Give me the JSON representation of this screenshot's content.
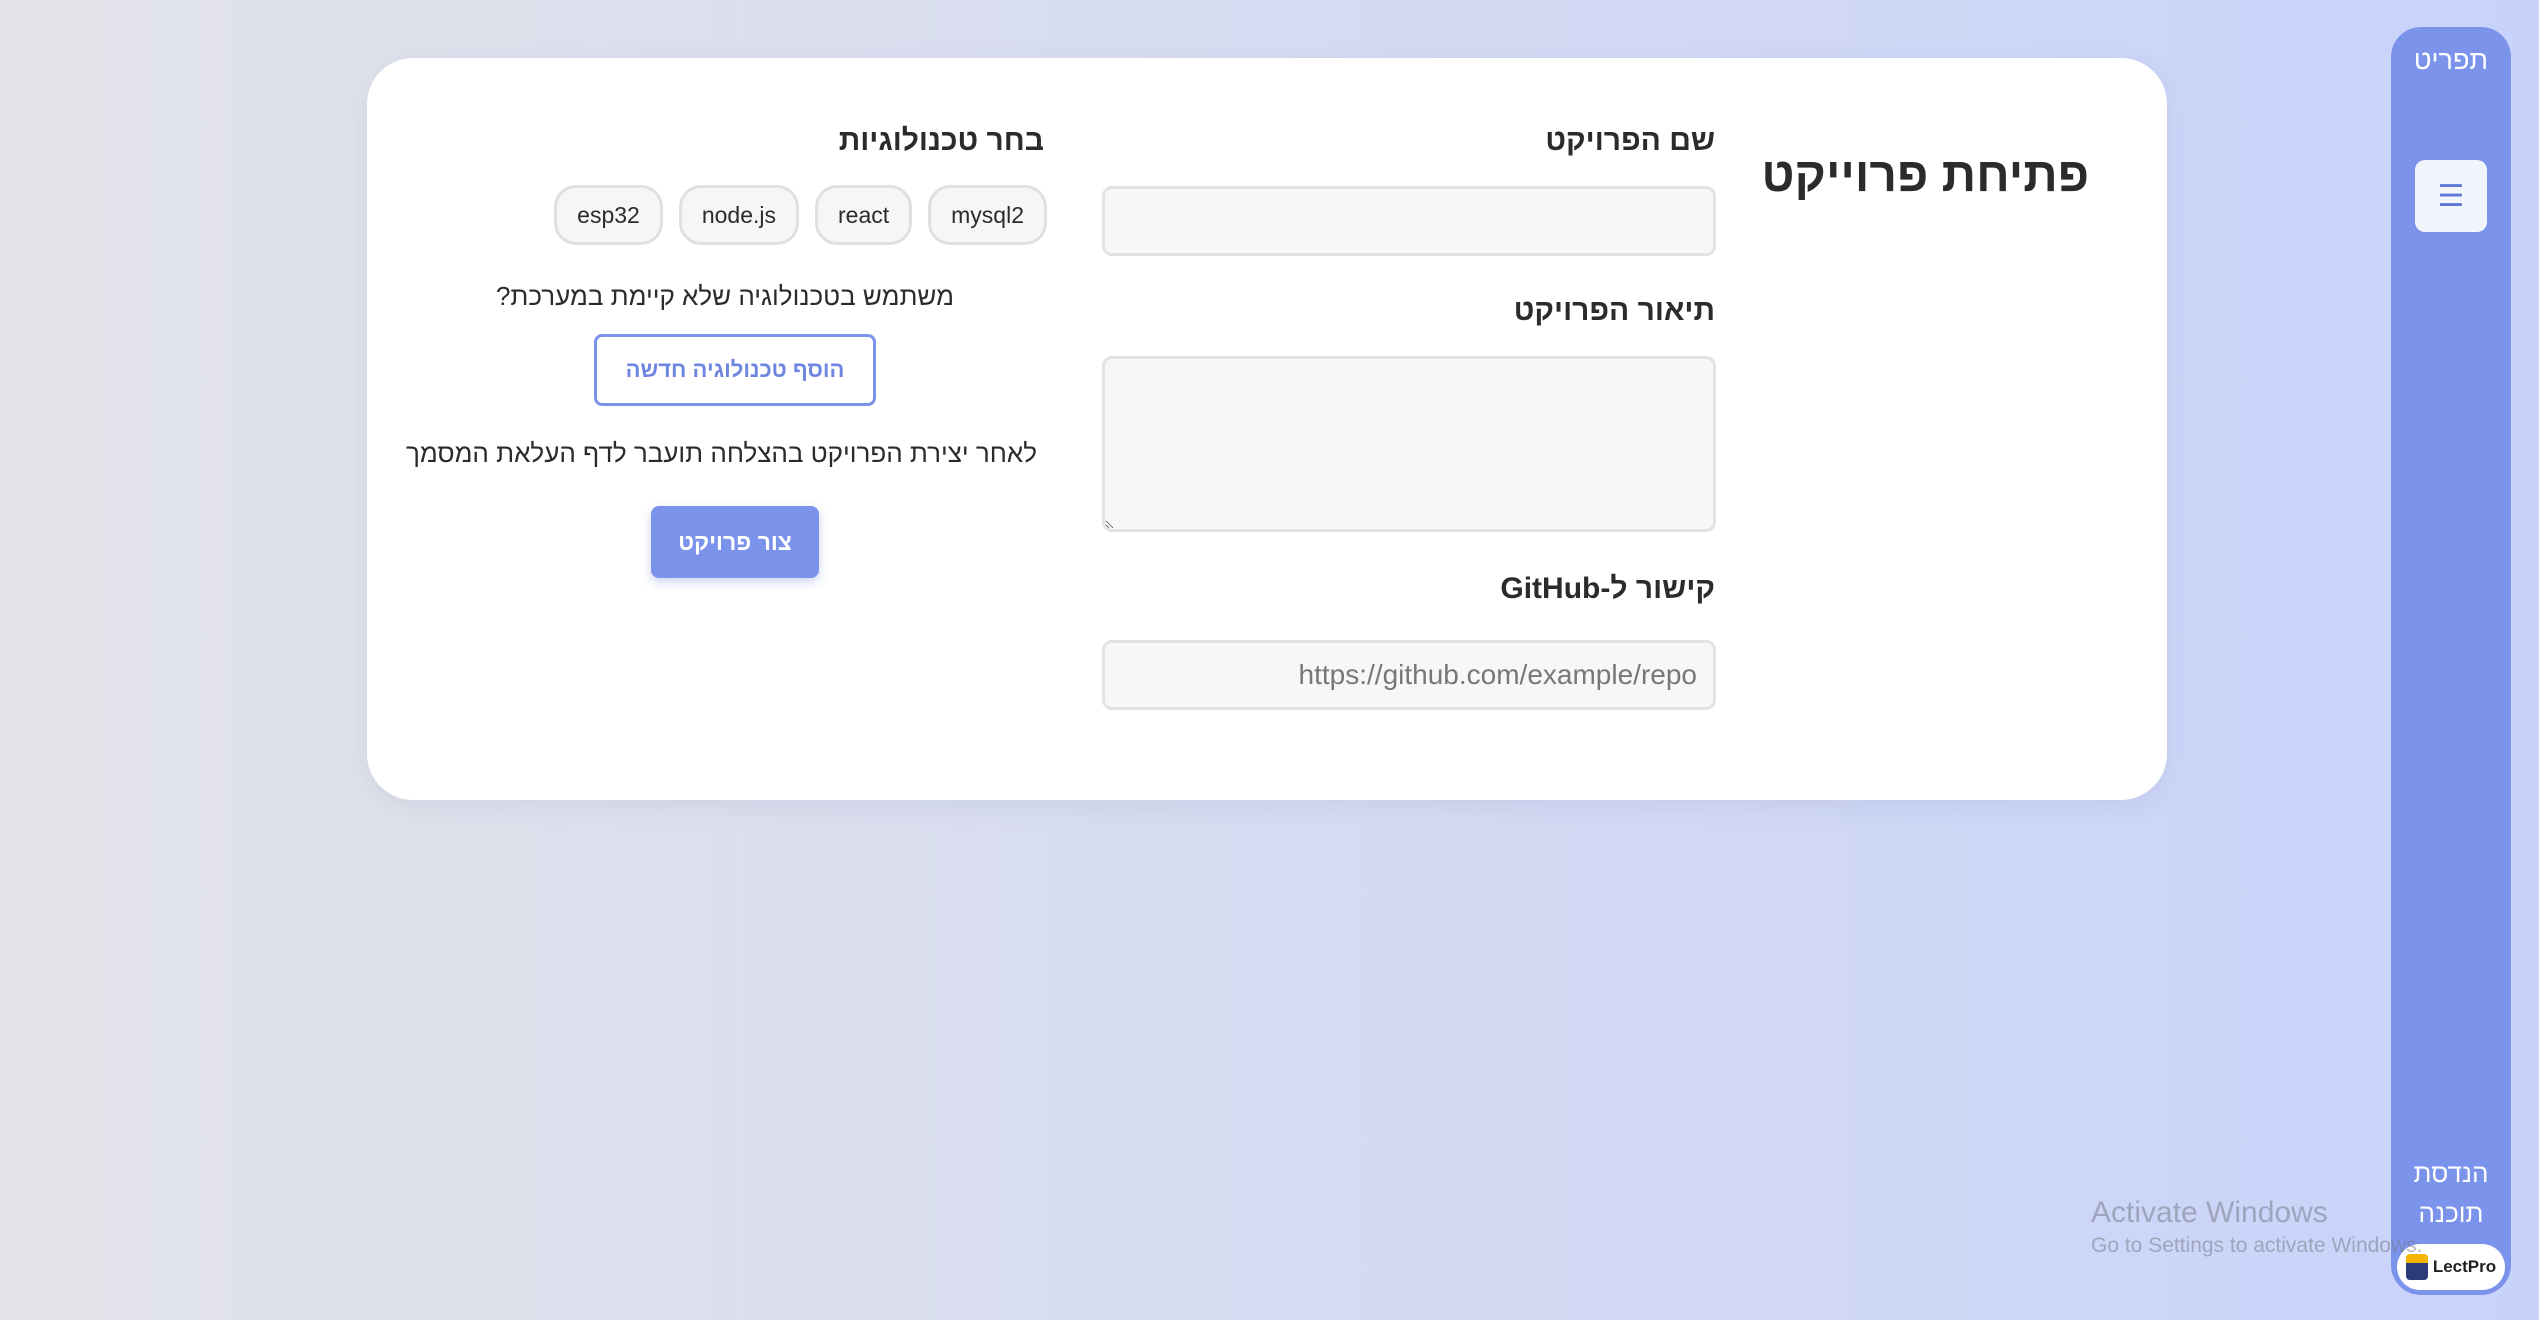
{
  "sidebar": {
    "title": "תפריט",
    "menu_icon": "☰",
    "department": "הנדסת תוכנה",
    "brand": "LectPro"
  },
  "page": {
    "title": "פתיחת פרוייקט"
  },
  "form": {
    "name_label": "שם הפרויקט",
    "name_value": "",
    "description_label": "תיאור הפרויקט",
    "description_value": "",
    "github_label": "קישור ל-GitHub",
    "github_placeholder": "https://github.com/example/repo",
    "github_value": ""
  },
  "technologies": {
    "label": "בחר טכנולוגיות",
    "options": [
      "mysql2",
      "react",
      "node.js",
      "esp32"
    ],
    "missing_prompt": "משתמש בטכנולוגיה שלא קיימת במערכת?",
    "add_button": "הוסף טכנולוגיה חדשה",
    "redirect_note": "לאחר יצירת הפרויקט בהצלחה תועבר לדף העלאת המסמך",
    "create_button": "צור פרויקט"
  },
  "watermark": {
    "line1": "Activate Windows",
    "line2": "Go to Settings to activate Windows."
  },
  "colors": {
    "accent": "#7b93ea",
    "card": "#ffffff",
    "text": "#2b2b2b"
  }
}
